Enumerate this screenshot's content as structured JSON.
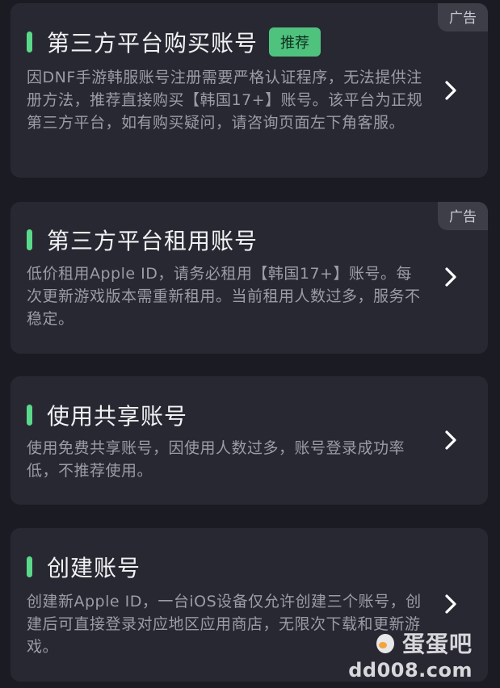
{
  "cards": [
    {
      "title": "第三方平台购买账号",
      "badge": "推荐",
      "ad": "广告",
      "desc": "因DNF手游韩服账号注册需要严格认证程序，无法提供注册方法，推荐直接购买【韩国17+】账号。该平台为正规第三方平台，如有购买疑问，请咨询页面左下角客服。"
    },
    {
      "title": "第三方平台租用账号",
      "ad": "广告",
      "desc": "低价租用Apple ID，请务必租用【韩国17+】账号。每次更新游戏版本需重新租用。当前租用人数过多，服务不稳定。"
    },
    {
      "title": "使用共享账号",
      "desc": "使用免费共享账号，因使用人数过多，账号登录成功率低，不推荐使用。"
    },
    {
      "title": "创建账号",
      "desc": "创建新Apple ID，一台iOS设备仅允许创建三个账号，创建后可直接登录对应地区应用商店，无限次下载和更新游戏。"
    }
  ],
  "watermark": {
    "brand": "蛋蛋吧",
    "url": "dd008.com"
  },
  "colors": {
    "background": "#1b1c23",
    "card": "#272832",
    "accent": "#5bd98a",
    "badge": "#4fc27e"
  }
}
